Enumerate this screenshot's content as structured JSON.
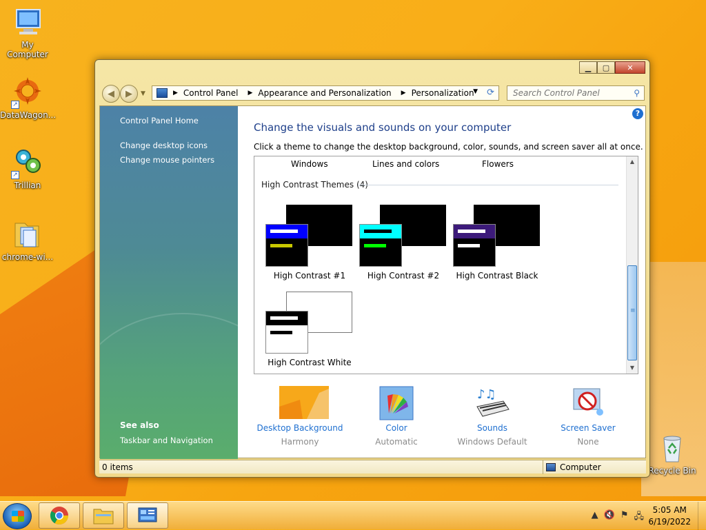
{
  "desktop": {
    "icons": [
      {
        "label": "My Computer"
      },
      {
        "label": "DataWagon..."
      },
      {
        "label": "Trillian"
      },
      {
        "label": "chrome-wi..."
      },
      {
        "label": "Recycle Bin"
      }
    ]
  },
  "window": {
    "address": {
      "crumbs": [
        "Control Panel",
        "Appearance and Personalization",
        "Personalization"
      ]
    },
    "search": {
      "placeholder": "Search Control Panel"
    },
    "sidebar": {
      "home": "Control Panel Home",
      "links": [
        "Change desktop icons",
        "Change mouse pointers"
      ],
      "see_also_title": "See also",
      "see_also_links": [
        "Taskbar and Navigation"
      ]
    },
    "main": {
      "title": "Change the visuals and sounds on your computer",
      "description": "Click a theme to change the desktop background, color, sounds, and screen saver all at once.",
      "top_row_labels": [
        "Windows",
        "Lines and colors",
        "Flowers"
      ],
      "group_heading": "High Contrast Themes (4)",
      "themes": [
        {
          "name": "High Contrast #1",
          "big_color": "#000000",
          "small_bg": "#000000",
          "title_color": "#0000ff",
          "bar1": "#ffffff",
          "bar2": "#c8c800"
        },
        {
          "name": "High Contrast #2",
          "big_color": "#000000",
          "small_bg": "#000000",
          "title_color": "#00ffff",
          "bar1": "#000000",
          "bar2": "#00ff00"
        },
        {
          "name": "High Contrast Black",
          "big_color": "#000000",
          "small_bg": "#000000",
          "title_color": "#3c1a7a",
          "bar1": "#ffffff",
          "bar2": "#ffffff"
        },
        {
          "name": "High Contrast White",
          "big_color": "#ffffff",
          "small_bg": "#ffffff",
          "title_color": "#000000",
          "bar1": "#ffffff",
          "bar2": "#000000"
        }
      ],
      "bottom": [
        {
          "name": "Desktop Background",
          "sub": "Harmony"
        },
        {
          "name": "Color",
          "sub": "Automatic"
        },
        {
          "name": "Sounds",
          "sub": "Windows Default"
        },
        {
          "name": "Screen Saver",
          "sub": "None"
        }
      ]
    },
    "status": {
      "items": "0 items",
      "location": "Computer"
    }
  },
  "taskbar": {
    "time": "5:05 AM",
    "date": "6/19/2022"
  }
}
